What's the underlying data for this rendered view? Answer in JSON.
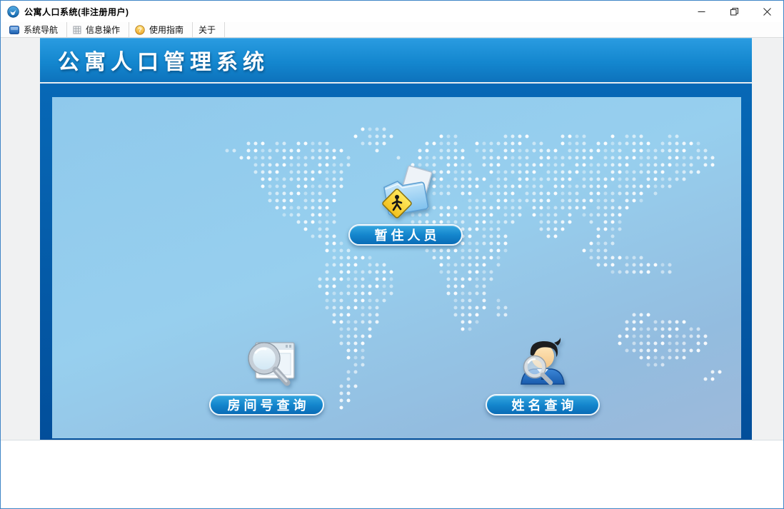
{
  "window": {
    "title": "公寓人口系统(非注册用户)"
  },
  "menu_bar": {
    "items": [
      {
        "label": "系统导航",
        "icon": "nav-square-icon"
      },
      {
        "label": "信息操作",
        "icon": "grid-icon"
      },
      {
        "label": "使用指南",
        "icon": "help-ball-icon"
      },
      {
        "label": "关于",
        "icon": ""
      }
    ]
  },
  "banner": {
    "title": "公寓人口管理系统"
  },
  "content": {
    "buttons": [
      {
        "label": "暂住人员",
        "icon": "folder-pedestrian-icon"
      },
      {
        "label": "房间号查询",
        "icon": "window-magnifier-icon"
      },
      {
        "label": "姓名查询",
        "icon": "person-magnifier-icon"
      }
    ]
  },
  "colors": {
    "banner_top": "#2a9ce1",
    "banner_bottom": "#0d72bc",
    "panel_frame": "#02519e",
    "map_light": "#94cbec",
    "map_dark": "#9db9da",
    "button_top": "#36a7e0",
    "button_bottom": "#0a6cb6",
    "dot": "#ffffff"
  },
  "map_dots": {
    "cell": 10,
    "radius": 2.5,
    "runs": [
      {
        "row": 4,
        "runs": [
          [
            43,
            46
          ]
        ]
      },
      {
        "row": 5,
        "runs": [
          [
            42,
            47
          ],
          [
            54,
            56
          ],
          [
            63,
            66
          ],
          [
            70,
            74
          ],
          [
            78,
            82
          ],
          [
            86,
            88
          ]
        ]
      },
      {
        "row": 6,
        "runs": [
          [
            27,
            32
          ],
          [
            34,
            38
          ],
          [
            43,
            46
          ],
          [
            52,
            57
          ],
          [
            59,
            68
          ],
          [
            71,
            90
          ]
        ]
      },
      {
        "row": 7,
        "runs": [
          [
            24,
            40
          ],
          [
            44,
            45
          ],
          [
            51,
            57
          ],
          [
            59,
            91
          ]
        ]
      },
      {
        "row": 8,
        "runs": [
          [
            26,
            41
          ],
          [
            48,
            48
          ],
          [
            51,
            58
          ],
          [
            60,
            92
          ]
        ]
      },
      {
        "row": 9,
        "runs": [
          [
            27,
            41
          ],
          [
            50,
            58
          ],
          [
            60,
            92
          ]
        ]
      },
      {
        "row": 10,
        "runs": [
          [
            28,
            41
          ],
          [
            51,
            59
          ],
          [
            61,
            90
          ]
        ]
      },
      {
        "row": 11,
        "runs": [
          [
            28,
            40
          ],
          [
            52,
            60
          ],
          [
            62,
            88
          ]
        ]
      },
      {
        "row": 12,
        "runs": [
          [
            29,
            40
          ],
          [
            52,
            59
          ],
          [
            61,
            86
          ]
        ]
      },
      {
        "row": 13,
        "runs": [
          [
            29,
            39
          ],
          [
            53,
            58
          ],
          [
            60,
            84
          ]
        ]
      },
      {
        "row": 14,
        "runs": [
          [
            30,
            39
          ],
          [
            58,
            82
          ]
        ]
      },
      {
        "row": 15,
        "runs": [
          [
            31,
            39
          ],
          [
            50,
            80
          ]
        ]
      },
      {
        "row": 16,
        "runs": [
          [
            32,
            39
          ],
          [
            50,
            65
          ],
          [
            67,
            72
          ],
          [
            74,
            79
          ]
        ]
      },
      {
        "row": 17,
        "runs": [
          [
            34,
            39
          ],
          [
            50,
            64
          ],
          [
            68,
            72
          ],
          [
            75,
            79
          ]
        ]
      },
      {
        "row": 18,
        "runs": [
          [
            35,
            38
          ],
          [
            51,
            62
          ],
          [
            68,
            71
          ],
          [
            76,
            79
          ]
        ]
      },
      {
        "row": 19,
        "runs": [
          [
            36,
            39
          ],
          [
            51,
            63
          ],
          [
            69,
            70
          ],
          [
            76,
            78
          ]
        ]
      },
      {
        "row": 20,
        "runs": [
          [
            37,
            40
          ],
          [
            52,
            63
          ],
          [
            75,
            78
          ]
        ]
      },
      {
        "row": 21,
        "runs": [
          [
            38,
            42
          ],
          [
            52,
            63
          ],
          [
            74,
            77
          ]
        ]
      },
      {
        "row": 22,
        "runs": [
          [
            39,
            44
          ],
          [
            53,
            62
          ],
          [
            75,
            82
          ]
        ]
      },
      {
        "row": 23,
        "runs": [
          [
            38,
            46
          ],
          [
            54,
            62
          ],
          [
            76,
            86
          ]
        ]
      },
      {
        "row": 24,
        "runs": [
          [
            38,
            47
          ],
          [
            54,
            61
          ],
          [
            78,
            86
          ]
        ]
      },
      {
        "row": 25,
        "runs": [
          [
            37,
            47
          ],
          [
            55,
            61
          ]
        ]
      },
      {
        "row": 26,
        "runs": [
          [
            37,
            47
          ],
          [
            55,
            60
          ]
        ]
      },
      {
        "row": 27,
        "runs": [
          [
            38,
            47
          ],
          [
            55,
            60
          ]
        ]
      },
      {
        "row": 28,
        "runs": [
          [
            38,
            46
          ],
          [
            56,
            60
          ],
          [
            62,
            62
          ]
        ]
      },
      {
        "row": 29,
        "runs": [
          [
            38,
            46
          ],
          [
            56,
            60
          ],
          [
            62,
            63
          ]
        ]
      },
      {
        "row": 30,
        "runs": [
          [
            39,
            45
          ],
          [
            56,
            59
          ],
          [
            62,
            63
          ],
          [
            81,
            83
          ]
        ]
      },
      {
        "row": 31,
        "runs": [
          [
            39,
            45
          ],
          [
            57,
            59
          ],
          [
            80,
            88
          ]
        ]
      },
      {
        "row": 32,
        "runs": [
          [
            40,
            44
          ],
          [
            57,
            58
          ],
          [
            79,
            90
          ]
        ]
      },
      {
        "row": 33,
        "runs": [
          [
            40,
            44
          ],
          [
            79,
            91
          ]
        ]
      },
      {
        "row": 34,
        "runs": [
          [
            40,
            43
          ],
          [
            79,
            91
          ]
        ]
      },
      {
        "row": 35,
        "runs": [
          [
            41,
            43
          ],
          [
            80,
            90
          ]
        ]
      },
      {
        "row": 36,
        "runs": [
          [
            41,
            43
          ],
          [
            81,
            88
          ]
        ]
      },
      {
        "row": 37,
        "runs": [
          [
            41,
            43
          ],
          [
            83,
            86
          ]
        ]
      },
      {
        "row": 38,
        "runs": [
          [
            41,
            42
          ],
          [
            92,
            93
          ]
        ]
      },
      {
        "row": 39,
        "runs": [
          [
            41,
            42
          ],
          [
            91,
            92
          ]
        ]
      },
      {
        "row": 40,
        "runs": [
          [
            40,
            42
          ]
        ]
      },
      {
        "row": 41,
        "runs": [
          [
            40,
            41
          ]
        ]
      },
      {
        "row": 42,
        "runs": [
          [
            40,
            41
          ]
        ]
      },
      {
        "row": 43,
        "runs": [
          [
            40,
            40
          ]
        ]
      }
    ]
  }
}
